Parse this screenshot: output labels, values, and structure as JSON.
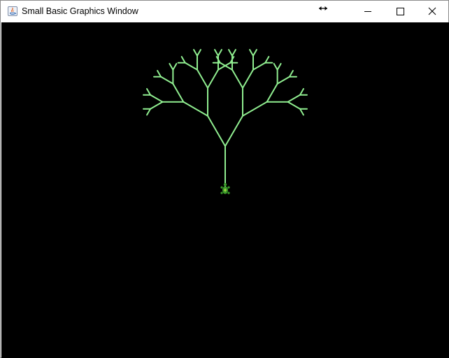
{
  "window": {
    "title": "Small Basic Graphics Window",
    "controls": {
      "minimize": "minimize",
      "maximize": "maximize",
      "close": "close"
    }
  },
  "canvas": {
    "background": "#000000",
    "pen_color": "#90EE90",
    "drawing": "fractal-tree",
    "turtle_color": "#3a9a2a"
  }
}
